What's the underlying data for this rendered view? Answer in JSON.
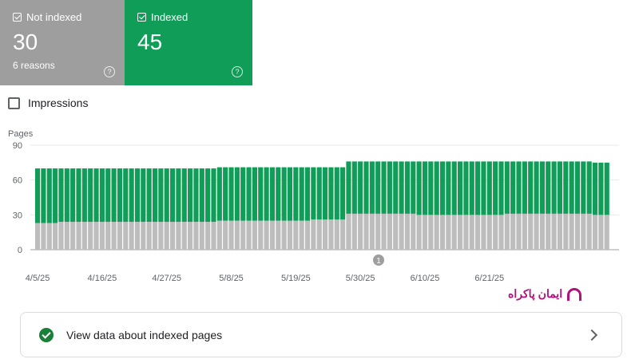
{
  "cards": {
    "not_indexed": {
      "label": "Not indexed",
      "value": "30",
      "sub": "6 reasons",
      "help": "?",
      "color": "#9e9e9e"
    },
    "indexed": {
      "label": "Indexed",
      "value": "45",
      "help": "?",
      "color": "#0f9d58"
    }
  },
  "impressions_label": "Impressions",
  "chart_data": {
    "type": "bar",
    "stacked": true,
    "ylabel": "Pages",
    "ylim": [
      0,
      90
    ],
    "yticks": [
      0,
      30,
      60,
      90
    ],
    "xtick_labels": [
      "4/5/25",
      "4/16/25",
      "4/27/25",
      "5/8/25",
      "5/19/25",
      "5/30/25",
      "6/10/25",
      "6/21/25"
    ],
    "annotation_marker": "1",
    "colors": {
      "not_indexed": "#bdbdbd",
      "indexed": "#0f9d58"
    },
    "series": [
      {
        "name": "Not indexed",
        "values": [
          23,
          23,
          23,
          23,
          24,
          24,
          24,
          24,
          24,
          24,
          24,
          24,
          24,
          24,
          24,
          24,
          24,
          24,
          24,
          24,
          24,
          24,
          24,
          24,
          24,
          24,
          24,
          24,
          24,
          24,
          24,
          25,
          25,
          25,
          25,
          25,
          25,
          25,
          25,
          25,
          25,
          25,
          25,
          25,
          25,
          25,
          25,
          26,
          26,
          26,
          26,
          26,
          26,
          31,
          31,
          31,
          31,
          31,
          31,
          31,
          31,
          31,
          31,
          31,
          31,
          30,
          30,
          30,
          30,
          30,
          30,
          30,
          30,
          30,
          30,
          30,
          30,
          30,
          30,
          30,
          31,
          31,
          31,
          31,
          31,
          31,
          31,
          31,
          31,
          31,
          31,
          31,
          31,
          31,
          31,
          30,
          30,
          30
        ]
      },
      {
        "name": "Indexed",
        "values": [
          47,
          47,
          47,
          47,
          46,
          46,
          46,
          46,
          46,
          46,
          46,
          46,
          46,
          46,
          46,
          46,
          46,
          46,
          46,
          46,
          46,
          46,
          46,
          46,
          46,
          46,
          46,
          46,
          46,
          46,
          46,
          46,
          46,
          46,
          46,
          46,
          46,
          46,
          46,
          46,
          46,
          46,
          46,
          46,
          46,
          46,
          46,
          45,
          45,
          45,
          45,
          45,
          45,
          45,
          45,
          45,
          45,
          45,
          45,
          45,
          45,
          45,
          45,
          45,
          45,
          46,
          46,
          46,
          46,
          46,
          46,
          46,
          46,
          46,
          46,
          46,
          46,
          46,
          46,
          46,
          45,
          45,
          45,
          45,
          45,
          45,
          45,
          45,
          45,
          45,
          45,
          45,
          45,
          45,
          45,
          45,
          45,
          45
        ]
      }
    ]
  },
  "watermark_text": "ایمان پاکراه",
  "bottom_card": {
    "label": "View data about indexed pages"
  }
}
